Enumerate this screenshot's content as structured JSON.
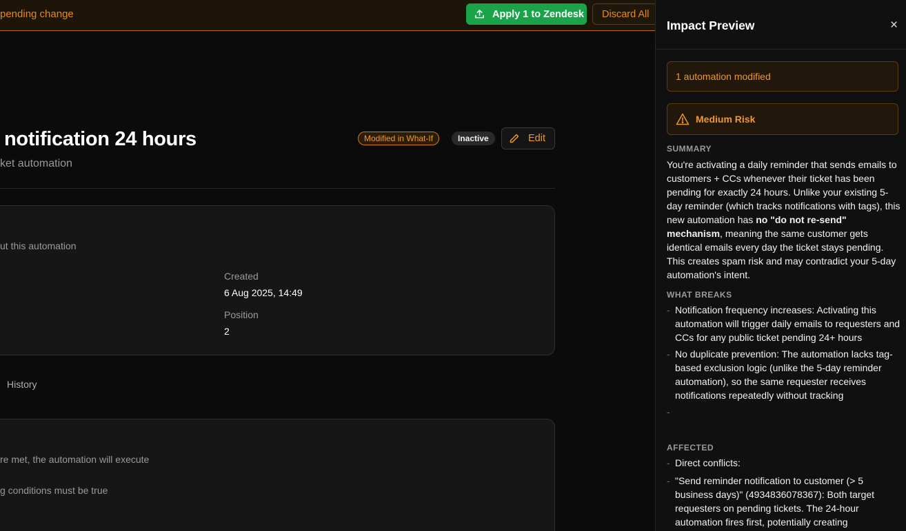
{
  "topbar": {
    "pending_text": "pending change",
    "apply_label": "Apply 1 to Zendesk",
    "discard_label": "Discard All"
  },
  "automation": {
    "title": "notification 24 hours",
    "subtitle": "ket automation",
    "badge_whatif": "Modified in What-If",
    "badge_status": "Inactive",
    "edit_label": "Edit"
  },
  "details": {
    "description": "ut this automation",
    "created_label": "Created",
    "created_value": "6 Aug 2025, 14:49",
    "position_label": "Position",
    "position_value": "2"
  },
  "tabs": {
    "history": "History"
  },
  "conditions": {
    "text1": "re met, the automation will execute",
    "text2": "g conditions must be true"
  },
  "panel": {
    "title": "Impact Preview",
    "close": "×",
    "modified_text": "1 automation modified",
    "risk_text": "Medium Risk",
    "summary_heading": "SUMMARY",
    "summary_part1": "You're activating a daily reminder that sends emails to customers + CCs whenever their ticket has been pending for exactly 24 hours. Unlike your existing 5-day reminder (which tracks notifications with tags), this new automation has ",
    "summary_bold": "no \"do not re-send\" mechanism",
    "summary_part2": ", meaning the same customer gets identical emails every day the ticket stays pending. This creates spam risk and may contradict your 5-day automation's intent.",
    "what_breaks_heading": "WHAT BREAKS",
    "what_breaks": [
      "Notification frequency increases: Activating this automation will trigger daily emails to requesters and CCs for any public ticket pending 24+ hours",
      "No duplicate prevention: The automation lacks tag-based exclusion logic (unlike the 5-day reminder automation), so the same requester receives notifications repeatedly without tracking",
      ""
    ],
    "affected_heading": "AFFECTED",
    "affected": [
      "Direct conflicts:",
      "\"Send reminder notification to customer (> 5 business days)\" (4934836078367): Both target requesters on pending tickets. The 24-hour automation fires first, potentially creating"
    ],
    "colors": {
      "accent": "#f0982b",
      "apply": "#1aa349",
      "dash": "#d4452f"
    }
  }
}
